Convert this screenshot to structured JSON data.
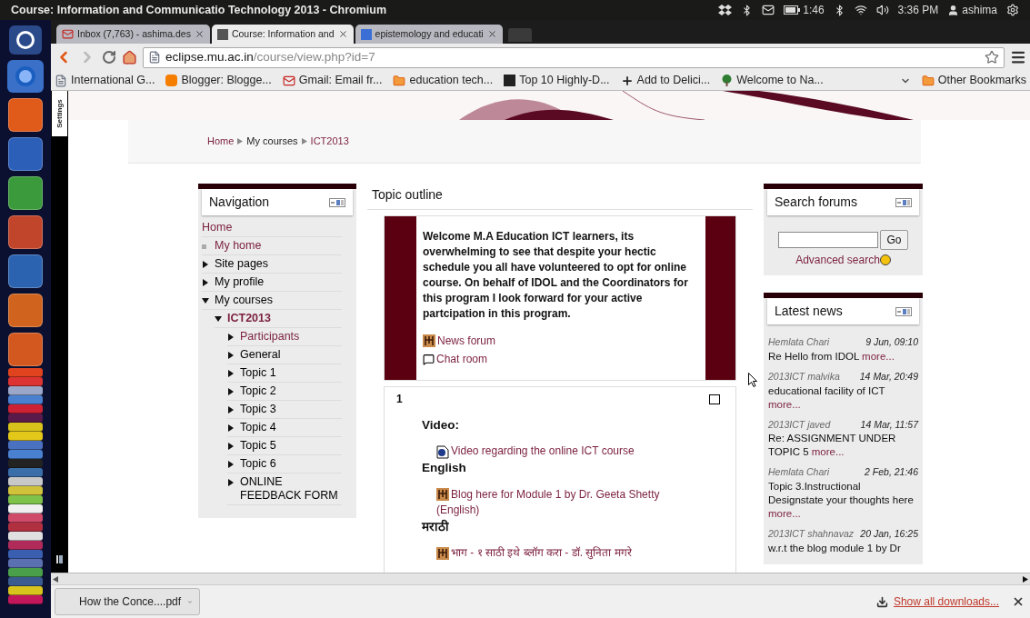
{
  "window": {
    "title": "Course: Information and Communicatio Technology 2013 - Chromium"
  },
  "indicators": {
    "battery_time": "1:46",
    "clock": "3:36 PM",
    "user": "ashima"
  },
  "tabs": [
    {
      "label": "Inbox (7,763) - ashima.des",
      "kind": "gmail",
      "selected": false
    },
    {
      "label": "Course: Information and",
      "kind": "moodle",
      "selected": true
    },
    {
      "label": "epistemology and educati",
      "kind": "google",
      "selected": false
    }
  ],
  "address": {
    "host": "eclipse.mu.ac.in",
    "path": "/course/view.php?id=7"
  },
  "bookmarks": [
    {
      "label": "International G...",
      "kind": "page"
    },
    {
      "label": "Blogger: Blogge...",
      "kind": "blogger"
    },
    {
      "label": "Gmail: Email fr...",
      "kind": "gmail"
    },
    {
      "label": "education tech...",
      "kind": "folder"
    },
    {
      "label": "Top 10 Highly-D...",
      "kind": "dark"
    },
    {
      "label": "Add to Delici...",
      "kind": "plus"
    },
    {
      "label": "Welcome to Na...",
      "kind": "tree"
    }
  ],
  "other_bookmarks": "Other Bookmarks",
  "side_tab": "Settings",
  "breadcrumb": [
    {
      "label": "Home",
      "link": true
    },
    {
      "label": "My courses",
      "link": false
    },
    {
      "label": "ICT2013",
      "link": true
    }
  ],
  "navigation": {
    "title": "Navigation",
    "items": [
      {
        "label": "Home",
        "kind": "root",
        "link": true,
        "current": false
      },
      {
        "label": "My home",
        "kind": "leaf",
        "link": true,
        "current": false
      },
      {
        "label": "Site pages",
        "kind": "branch",
        "expanded": false,
        "link": false,
        "current": false
      },
      {
        "label": "My profile",
        "kind": "branch",
        "expanded": false,
        "link": false,
        "current": false
      },
      {
        "label": "My courses",
        "kind": "branch",
        "expanded": true,
        "link": false,
        "current": false,
        "children": [
          {
            "label": "ICT2013",
            "kind": "branch",
            "expanded": true,
            "link": true,
            "current": true,
            "children": [
              {
                "label": "Participants",
                "kind": "branch",
                "expanded": false,
                "link": true,
                "current": false
              },
              {
                "label": "General",
                "kind": "branch",
                "expanded": false,
                "link": false,
                "current": false
              },
              {
                "label": "Topic 1",
                "kind": "branch",
                "expanded": false,
                "link": false,
                "current": false
              },
              {
                "label": "Topic 2",
                "kind": "branch",
                "expanded": false,
                "link": false,
                "current": false
              },
              {
                "label": "Topic 3",
                "kind": "branch",
                "expanded": false,
                "link": false,
                "current": false
              },
              {
                "label": "Topic 4",
                "kind": "branch",
                "expanded": false,
                "link": false,
                "current": false
              },
              {
                "label": "Topic 5",
                "kind": "branch",
                "expanded": false,
                "link": false,
                "current": false
              },
              {
                "label": "Topic 6",
                "kind": "branch",
                "expanded": false,
                "link": false,
                "current": false
              },
              {
                "label": "ONLINE FEEDBACK FORM",
                "kind": "branch",
                "expanded": false,
                "link": false,
                "current": false
              }
            ]
          }
        ]
      }
    ]
  },
  "outline": {
    "title": "Topic outline",
    "welcome": {
      "text": "Welcome  M.A Education ICT learners, its overwhelming to see that despite your hectic schedule you all have volunteered to opt for online course. On behalf of IDOL and the Coordinators for this program I look forward for your active partcipation in this program.",
      "activities": [
        {
          "kind": "forum",
          "label": "News forum"
        },
        {
          "kind": "chat",
          "label": "Chat room"
        }
      ]
    },
    "section": {
      "number": "1",
      "blocks": [
        {
          "kind": "heading",
          "text": "Video:"
        },
        {
          "kind": "video",
          "text": "Video regarding the online ICT course"
        },
        {
          "kind": "label",
          "text": "English"
        },
        {
          "kind": "blog",
          "text": "Blog here for Module 1 by Dr. Geeta Shetty (English)"
        },
        {
          "kind": "label",
          "text": "मराठी"
        },
        {
          "kind": "blog",
          "text": "भाग - १ साठी इथे ब्लॉग करा - डॉ. सुनिता मगरे"
        }
      ]
    }
  },
  "search_forums": {
    "title": "Search forums",
    "button": "Go",
    "advanced": "Advanced search"
  },
  "latest_news": {
    "title": "Latest news",
    "items": [
      {
        "author": "Hemlata Chari",
        "date": "9 Jun, 09:10",
        "subject": "Re Hello from IDOL",
        "more": "more..."
      },
      {
        "author": "2013ICT malvika",
        "date": "14 Mar, 20:49",
        "subject": "educational facility of ICT",
        "more": "more..."
      },
      {
        "author": "2013ICT javed",
        "date": "14 Mar, 11:57",
        "subject": "Re: ASSIGNMENT UNDER TOPIC 5",
        "more": "more..."
      },
      {
        "author": "Hemlata Chari",
        "date": "2 Feb, 21:46",
        "subject": "Topic 3.Instructional Designstate your thoughts here",
        "more": "more..."
      },
      {
        "author": "2013ICT shahnavaz",
        "date": "20 Jan, 16:25",
        "subject": "w.r.t the blog module 1 by Dr"
      }
    ]
  },
  "downloads": {
    "file": "How the Conce....pdf",
    "show_all": "Show all downloads..."
  }
}
